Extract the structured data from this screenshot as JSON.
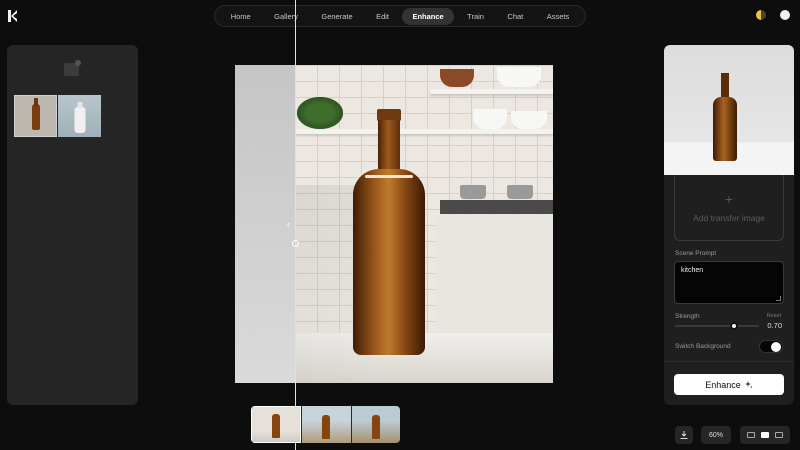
{
  "nav": {
    "items": [
      {
        "label": "Home"
      },
      {
        "label": "Gallery"
      },
      {
        "label": "Generate"
      },
      {
        "label": "Edit"
      },
      {
        "label": "Enhance",
        "active": true
      },
      {
        "label": "Train"
      },
      {
        "label": "Chat"
      },
      {
        "label": "Assets"
      }
    ]
  },
  "right_panel": {
    "transfer_label": "Add transfer image",
    "scene_prompt_label": "Scene Prompt",
    "scene_prompt_value": "kitchen",
    "strength_label": "Strength",
    "reset_label": "Reset",
    "strength_value": "0.70",
    "switch_background_label": "Switch Background",
    "switch_background_on": true,
    "enhance_label": "Enhance"
  },
  "bottom": {
    "zoom_label": "60%"
  },
  "icons": {
    "logo": "logo-icon",
    "theme": "theme-icon",
    "account": "account-icon",
    "folder": "folder-icon",
    "download": "download-icon",
    "enhance": "sparkle-icon"
  },
  "colors": {
    "background": "#0d0d0d",
    "panel": "#252525",
    "active_tab": "#333333",
    "primary_button": "#ffffff"
  }
}
